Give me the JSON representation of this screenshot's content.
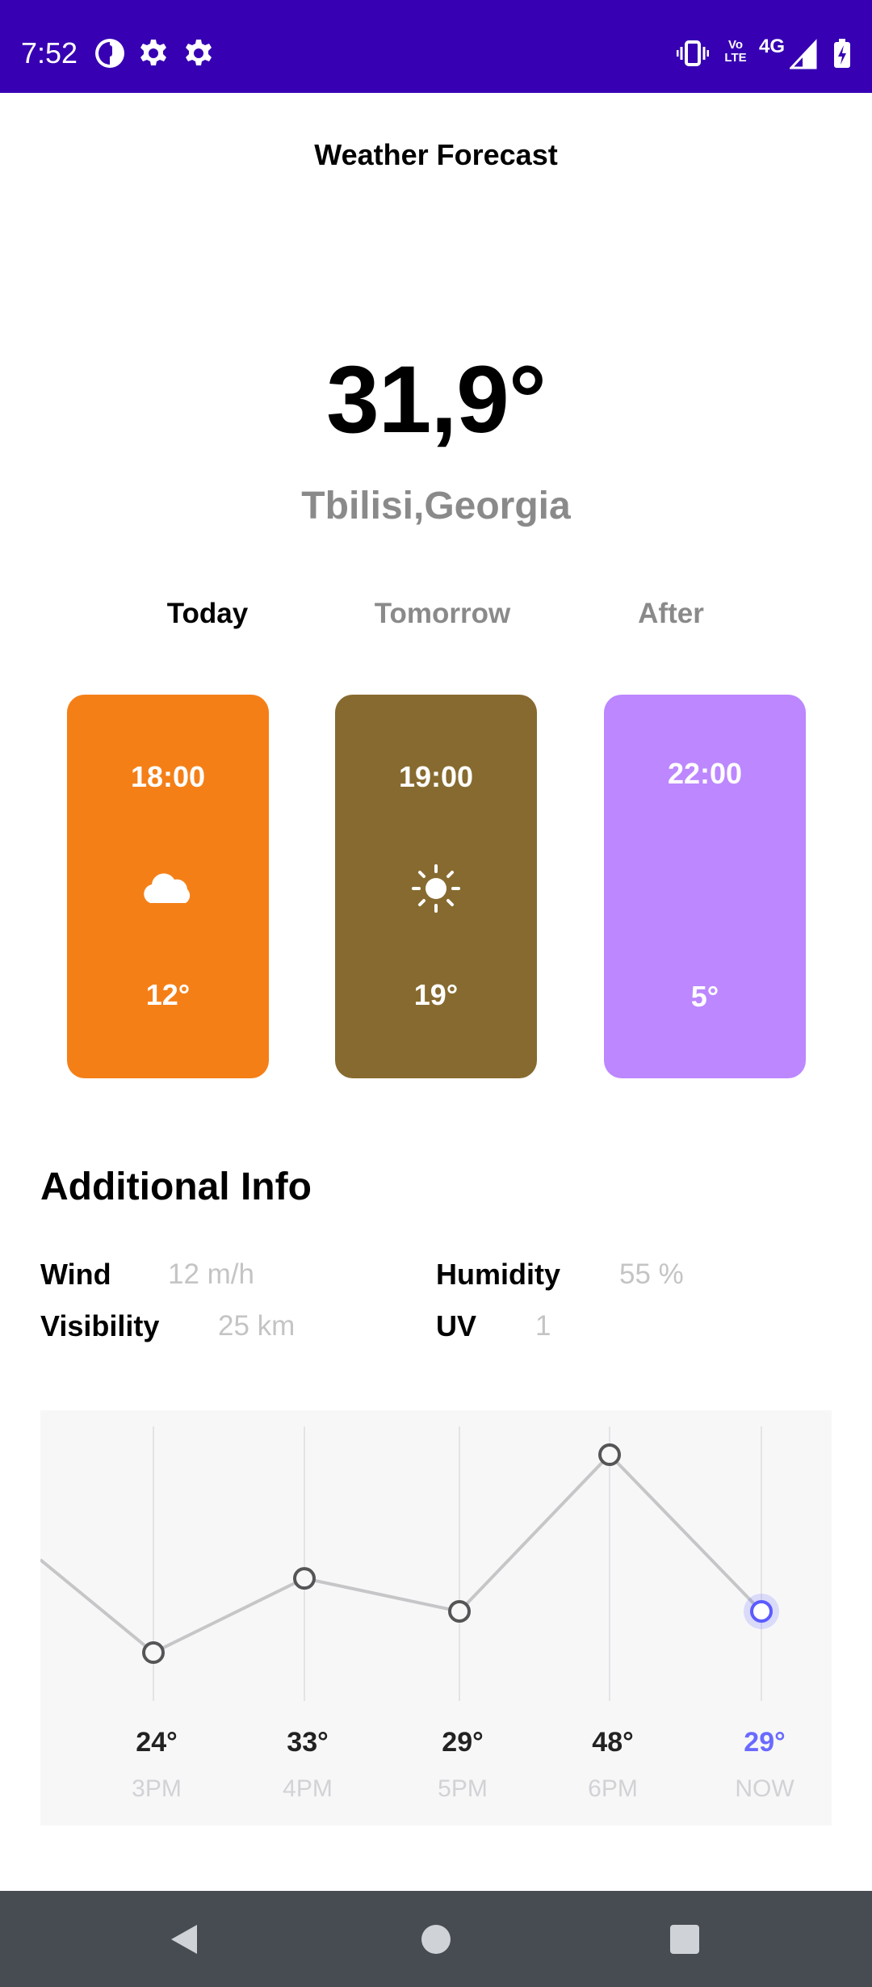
{
  "status_bar": {
    "time": "7:52",
    "network": "4G",
    "volte": "Vo LTE",
    "background": "#3700b3",
    "left_icons": [
      "app-notification-icon",
      "settings-icon",
      "settings-icon"
    ],
    "right_icons": [
      "vibrate-icon",
      "volte-icon",
      "signal-icon",
      "battery-charging-icon"
    ]
  },
  "app": {
    "title": "Weather Forecast",
    "current_icon": "moon-icon",
    "temperature": "31,9°",
    "location": "Tbilisi,Georgia"
  },
  "tabs": [
    {
      "label": "Today",
      "selected": true
    },
    {
      "label": "Tomorrow",
      "selected": false
    },
    {
      "label": "After",
      "selected": false
    }
  ],
  "forecast_cards": [
    {
      "time": "18:00",
      "icon": "cloud-icon",
      "temp": "12°",
      "color": "#f57f17"
    },
    {
      "time": "19:00",
      "icon": "sun-icon",
      "temp": "19°",
      "color": "#876a2f"
    },
    {
      "time": "22:00",
      "icon": "moon-icon",
      "temp": "5°",
      "color": "#bc87ff"
    }
  ],
  "additional_info": {
    "title": "Additional Info",
    "wind": {
      "label": "Wind",
      "value": "12 m/h"
    },
    "humidity": {
      "label": "Humidity",
      "value": "55 %"
    },
    "visibility": {
      "label": "Visibility",
      "value": "25 km"
    },
    "uv": {
      "label": "UV",
      "value": "1"
    }
  },
  "chart_data": {
    "type": "line",
    "categories": [
      "3PM",
      "4PM",
      "5PM",
      "6PM",
      "NOW"
    ],
    "values": [
      24,
      33,
      29,
      48,
      29
    ],
    "value_labels": [
      "24°",
      "33°",
      "29°",
      "48°",
      "29°"
    ],
    "highlight_index": 4,
    "highlight_color": "#5b5bff",
    "grid": true
  },
  "colors": {
    "accent_moon": "#f9b826",
    "muted_text": "#8a8a8a",
    "nav_bar": "#474c52"
  },
  "nav_bar": {
    "buttons": [
      "back-icon",
      "home-icon",
      "recents-icon"
    ]
  }
}
